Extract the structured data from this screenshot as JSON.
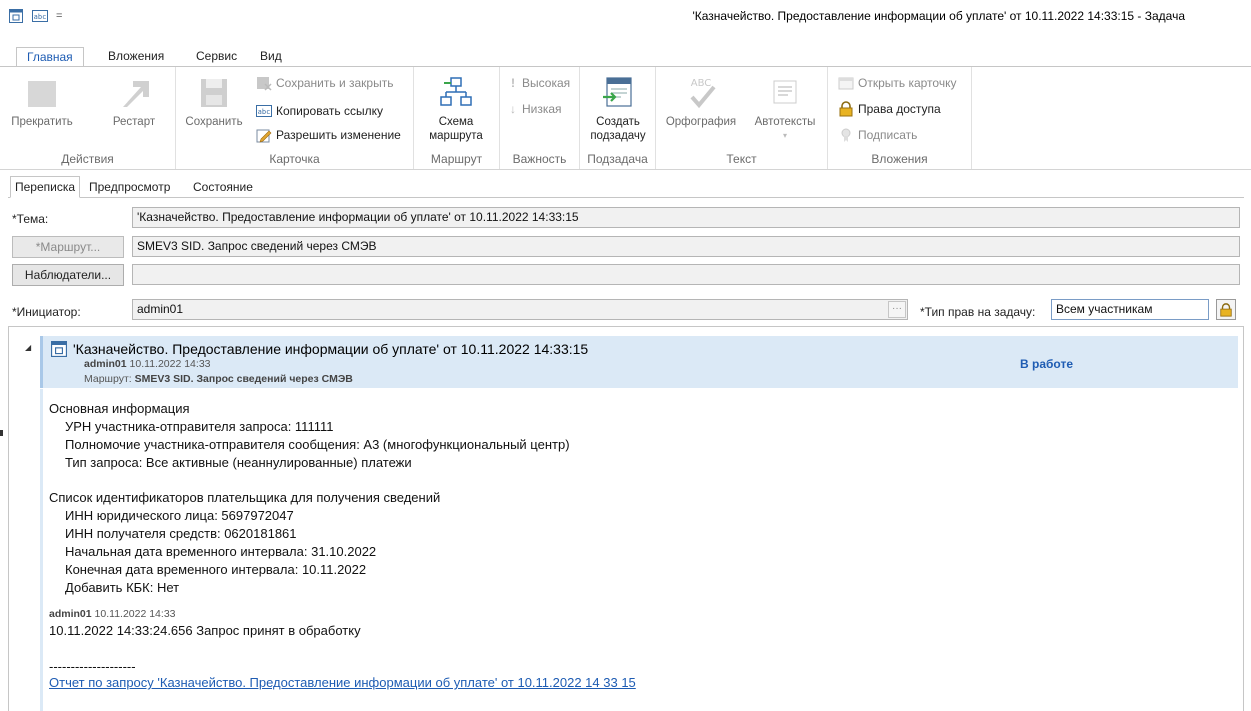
{
  "window": {
    "title": "'Казначейство. Предоставление информации об уплате' от 10.11.2022 14:33:15 - Задача",
    "qat_separator": "="
  },
  "ribbon_tabs": [
    {
      "label": "Главная",
      "active": true
    },
    {
      "label": "Вложения"
    },
    {
      "label": "Сервис"
    },
    {
      "label": "Вид"
    }
  ],
  "ribbon": {
    "actions": {
      "label": "Действия",
      "stop": "Прекратить",
      "restart": "Рестарт"
    },
    "card": {
      "label": "Карточка",
      "save": "Сохранить",
      "save_close": "Сохранить и закрыть",
      "copy_link": "Копировать ссылку",
      "allow_edit": "Разрешить изменение"
    },
    "route": {
      "label": "Маршрут",
      "scheme_line1": "Схема",
      "scheme_line2": "маршрута"
    },
    "importance": {
      "label": "Важность",
      "high": "Высокая",
      "low": "Низкая"
    },
    "subtask": {
      "label": "Подзадача",
      "create_line1": "Создать",
      "create_line2": "подзадачу"
    },
    "text": {
      "label": "Текст",
      "spelling": "Орфография",
      "autotexts": "Автотексты",
      "abc": "ABC"
    },
    "attachments": {
      "label": "Вложения",
      "open_card": "Открыть карточку",
      "access": "Права доступа",
      "sign": "Подписать"
    }
  },
  "subtabs": [
    {
      "label": "Переписка",
      "active": true
    },
    {
      "label": "Предпросмотр"
    },
    {
      "label": "Состояние"
    }
  ],
  "form": {
    "subject_label": "*Тема:",
    "subject_value": "'Казначейство. Предоставление информации об уплате' от 10.11.2022 14:33:15",
    "route_button": "*Маршрут...",
    "route_value": "SMEV3 SID. Запрос сведений через СМЭВ",
    "observers_button": "Наблюдатели...",
    "observers_value": "",
    "initiator_label": "*Инициатор:",
    "initiator_value": "admin01",
    "ellipsis": "···",
    "rights_label": "*Тип прав на задачу:",
    "rights_value": "Всем участникам"
  },
  "correspondence": {
    "title": "'Казначейство. Предоставление информации об уплате' от 10.11.2022 14:33:15",
    "author": "admin01",
    "date": "10.11.2022 14:33",
    "route_label": "Маршрут:",
    "route_value": "SMEV3 SID. Запрос сведений через СМЭВ",
    "status": "В работе",
    "body": [
      "Основная информация",
      "УРН участника-отправителя запроса: 111111",
      "Полномочие участника-отправителя сообщения: А3 (многофункциональный центр)",
      "Тип запроса: Все активные (неаннулированные) платежи",
      "Список идентификаторов плательщика для получения сведений",
      "ИНН юридического лица: 5697972047",
      "ИНН получателя средств: 0620181861",
      "Начальная дата временного интервала: 31.10.2022",
      "Конечная дата временного интервала: 10.11.2022",
      "Добавить КБК: Нет"
    ],
    "reply_author": "admin01",
    "reply_date": "10.11.2022 14:33",
    "reply_text": "10.11.2022 14:33:24.656 Запрос принят в обработку",
    "separator": "--------------------",
    "report_link": "Отчет по запросу 'Казначейство. Предоставление информации об уплате' от 10.11.2022 14 33 15"
  }
}
